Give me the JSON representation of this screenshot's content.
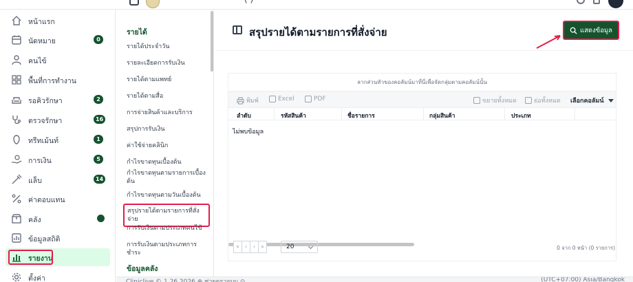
{
  "top_bar": {
    "paren_text": "(                )"
  },
  "sidebar": {
    "items": [
      {
        "label": "หน้าแรก",
        "icon": "home-icon",
        "badge": ""
      },
      {
        "label": "นัดหมาย",
        "icon": "calendar-icon",
        "badge": "0"
      },
      {
        "label": "คนไข้",
        "icon": "user-icon",
        "badge": ""
      },
      {
        "label": "พื้นที่การทำงาน",
        "icon": "workspace-icon",
        "badge": ""
      },
      {
        "label": "รอคิวรักษา",
        "icon": "sofa-icon",
        "badge": "2"
      },
      {
        "label": "ตรวจรักษา",
        "icon": "stethoscope-icon",
        "badge": "16"
      },
      {
        "label": "ทรีทเม้นท์",
        "icon": "treatment-icon",
        "badge": "1"
      },
      {
        "label": "การเงิน",
        "icon": "money-hand-icon",
        "badge": "5"
      },
      {
        "label": "แล็บ",
        "icon": "syringe-icon",
        "badge": "14"
      },
      {
        "label": "ค่าตอบแทน",
        "icon": "percent-icon",
        "badge": ""
      },
      {
        "label": "คลัง",
        "icon": "box-icon",
        "badge": ""
      },
      {
        "label": "ข้อมูลสถิติ",
        "icon": "stats-icon",
        "badge": ""
      },
      {
        "label": "รายงาน",
        "icon": "bar-chart-icon",
        "badge": ""
      },
      {
        "label": "ตั้งค่า",
        "icon": "gear-icon",
        "badge": ""
      }
    ]
  },
  "submenu": {
    "heading": "รายได้",
    "items": [
      "รายได้ประจำวัน",
      "รายละเอียดการรับเงิน",
      "รายได้ตามแพทย์",
      "รายได้ตามสื่อ",
      "การจ่ายสินค้าและบริการ",
      "สรุปการรับเงิน",
      "ค่าใช้จ่ายคลินิก",
      "กำไรขาดทุนเบื้องต้น",
      "กำไรขาดทุนตามรายการเบื้องต้น",
      "กำไรขาดทุนตามวันเบื้องต้น",
      "สรุปรายได้ตามรายการที่สั่งจ่าย",
      "การรับเงินตามประเภทคนไข้",
      "การรับเงินตามประเภทการชำระ"
    ],
    "heading2": "ข้อมูลคลัง"
  },
  "main": {
    "title": "สรุปรายได้ตามรายการที่สั่งจ่าย",
    "show_button": "แสดงข้อมูล",
    "group_hint": "ลากส่วนหัวของคอลัมน์มาที่นี่เพื่อจัดกลุ่มตามคอลัมน์นั้น",
    "toolbar": {
      "print": "พิมพ์",
      "excel": "Excel",
      "pdf": "PDF",
      "expand_all": "ขยายทั้งหมด",
      "collapse_all": "ย่อทั้งหมด",
      "choose_columns": "เลือกคอลัมน์"
    },
    "columns": [
      "ลำดับ",
      "รหัสสินค้า",
      "ชื่อรายการ",
      "กลุ่มสินค้า",
      "ประเภท"
    ],
    "no_data": "ไม่พบข้อมูล",
    "pager": {
      "buttons": [
        "«",
        "‹",
        "›",
        "»"
      ],
      "page_size": "20",
      "info": "0 จาก 0 หน้า (0 รายการ)"
    }
  },
  "footer": {
    "left": "Cliniclive © 1.26.2026   ⊕ ช่วยตรวจบบ ⊙",
    "right": "(UTC+07:00) Asia/Bangkok"
  },
  "colors": {
    "brand": "#14532d",
    "highlight": "#e11d48",
    "active_bg": "#dcfce7"
  }
}
